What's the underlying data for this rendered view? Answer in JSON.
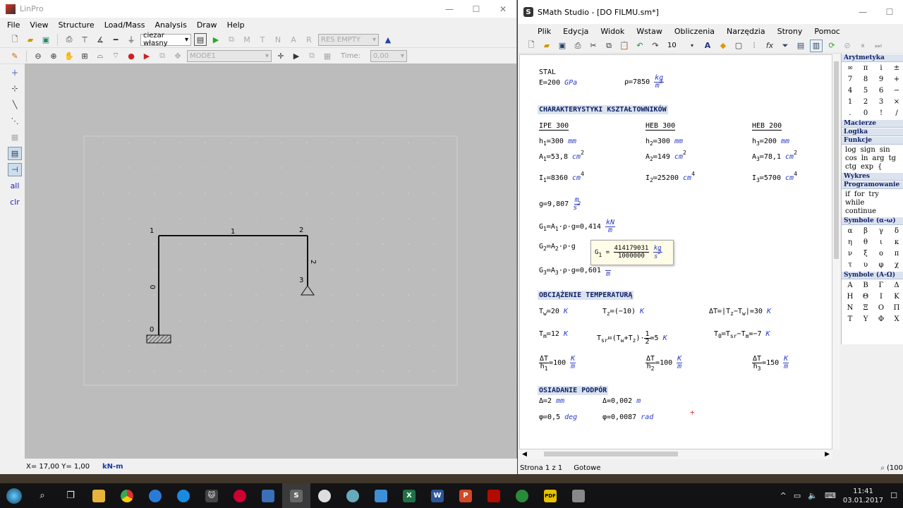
{
  "linpro": {
    "title": "LinPro",
    "menu": [
      "File",
      "View",
      "Structure",
      "Load/Mass",
      "Analysis",
      "Draw",
      "Help"
    ],
    "load_case": "ciezar własny",
    "res_combo": "RES EMPTY",
    "mode_combo": "MODE1",
    "time_label": "Time:",
    "time_value": "0,00",
    "left_tools": {
      "all": "all",
      "clr": "clr"
    },
    "nodes": [
      "0",
      "1",
      "2",
      "3"
    ],
    "members": [
      "0",
      "1",
      "2"
    ],
    "status_coords": "X= 17,00  Y= 1,00",
    "status_units": "kN-m"
  },
  "smath": {
    "title": "SMath Studio - [DO FILMU.sm*]",
    "menu": [
      "Plik",
      "Edycja",
      "Widok",
      "Wstaw",
      "Obliczenia",
      "Narzędzia",
      "Strony",
      "Pomoc"
    ],
    "font_size": "10",
    "status_page": "Strona 1 z 1",
    "status_ready": "Gotowe",
    "zoom": "(100",
    "doc": {
      "stal": "STAL",
      "E_lhs": "E≔200",
      "E_unit": "GPa",
      "rho_lhs": "ρ≔7850",
      "rho_unit_num": "kg",
      "rho_unit_den": "m",
      "rho_unit_pow": "3",
      "hdr_ksztaltowniki": "CHARAKTERYSTYKI KSZTAŁTOWNIKÓW",
      "ipe": "IPE 300",
      "heb300": "HEB 300",
      "heb200": "HEB 200",
      "h1": "300",
      "h2": "300",
      "h3": "200",
      "A1": "53,8",
      "A2": "149",
      "A3": "78,1",
      "I1": "8360",
      "I2": "25200",
      "I3": "5700",
      "mm": "mm",
      "cm": "cm",
      "pow2": "2",
      "pow4": "4",
      "g_val": "9,807",
      "g_unit_num": "m",
      "g_unit_den": "s",
      "G1_expr": "A",
      "G1_rest": "·ρ·g≔0,414",
      "G2_rest": "·ρ·g",
      "G3_rest": "·ρ·g≔0,601",
      "kN": "kN",
      "m": "m",
      "tooltip_num": "414179031",
      "tooltip_den": "1000000",
      "tooltip_unit_num": "kg",
      "tooltip_unit_den": "s",
      "hdr_temp": "OBCIĄŻENIE TEMPERATURĄ",
      "Tw": "20",
      "Tz": "(−10)",
      "dT": "=30",
      "Tm": "12",
      "Tsr": "=5",
      "T0": "=−7",
      "K": "K",
      "half": "1",
      "half_den": "2",
      "dTh1": "100",
      "dTh2": "100",
      "dTh3": "150",
      "hdr_osiadanie": "OSIADANIE PODPÓR",
      "delta1": "Δ≔2",
      "delta2": "Δ=0,002",
      "phi1": "φ≔0,5",
      "phi2": "φ=0,0087",
      "deg": "deg",
      "rad": "rad"
    },
    "panel": {
      "arytmetyka": "Arytmetyka",
      "arith": [
        "∞",
        "π",
        "i",
        "±",
        "7",
        "8",
        "9",
        "+",
        "4",
        "5",
        "6",
        "−",
        "1",
        "2",
        "3",
        "×",
        ".",
        "0",
        "!",
        "/"
      ],
      "macierze": "Macierze",
      "logika": "Logika",
      "funkcje": "Funkcje",
      "funcs": [
        "log",
        "sign",
        "sin",
        "cos",
        "ln",
        "arg",
        "tg",
        "ctg",
        "exp",
        "{"
      ],
      "wykres": "Wykres",
      "programowanie": "Programowanie",
      "prog": [
        "if",
        "for",
        "try",
        "while",
        "continue"
      ],
      "greek_lower_title": "Symbole (α-ω)",
      "greek_lower": [
        "α",
        "β",
        "γ",
        "δ",
        "η",
        "θ",
        "ι",
        "κ",
        "ν",
        "ξ",
        "ο",
        "π",
        "τ",
        "υ",
        "φ",
        "χ"
      ],
      "greek_upper_title": "Symbole (Α-Ω)",
      "greek_upper": [
        "Α",
        "Β",
        "Γ",
        "Δ",
        "Η",
        "Θ",
        "Ι",
        "Κ",
        "Ν",
        "Ξ",
        "Ο",
        "Π",
        "Τ",
        "Υ",
        "Φ",
        "Χ"
      ]
    }
  },
  "taskbar": {
    "time": "11:41",
    "date": "03.01.2017"
  }
}
